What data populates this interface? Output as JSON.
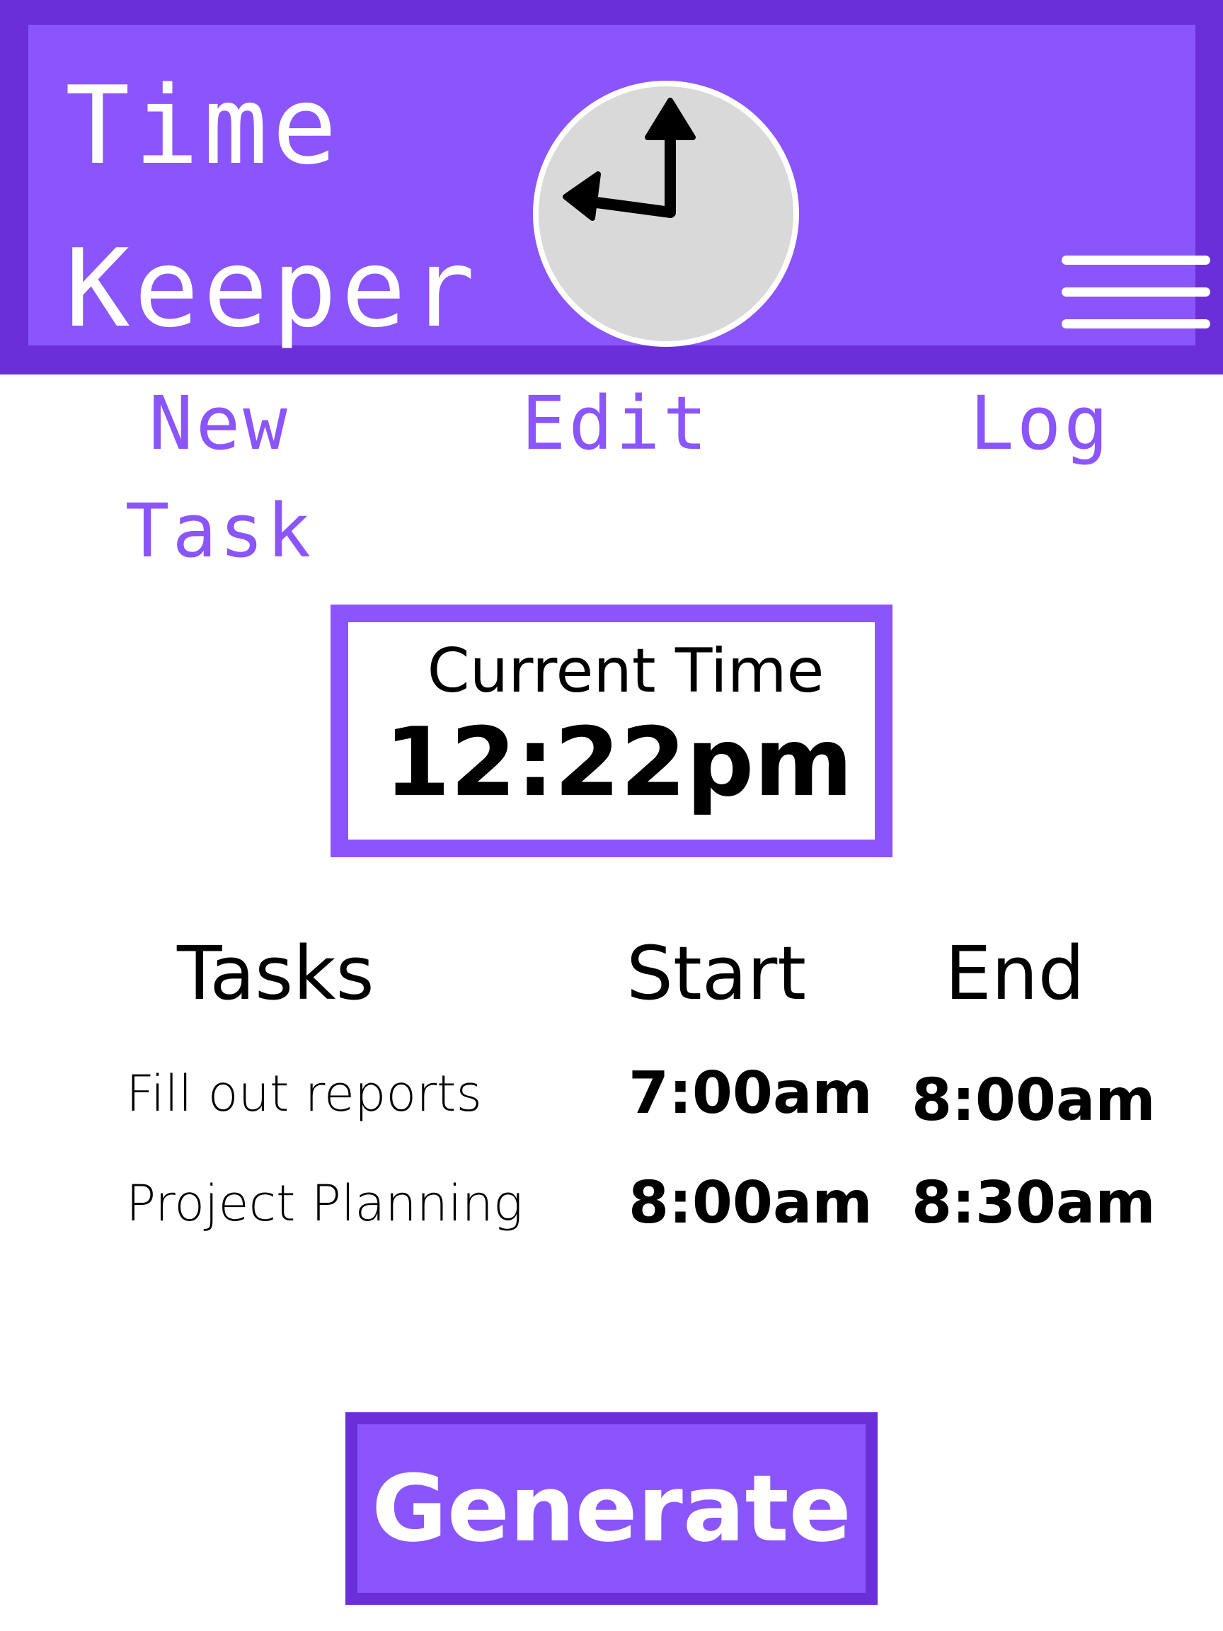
{
  "colors": {
    "header_border": "#6a2fd8",
    "accent": "#8b55fd",
    "clock_face": "#d9d9d9",
    "text": "#000000",
    "on_accent": "#ffffff"
  },
  "header": {
    "title_line1": "Time",
    "title_line2": "Keeper",
    "logo_icon": "clock-icon",
    "menu_icon": "hamburger-menu-icon"
  },
  "nav": {
    "new_line1": "New",
    "new_line2": "Task",
    "edit": "Edit",
    "log": "Log"
  },
  "current_time": {
    "label": "Current Time",
    "value": "12:22pm"
  },
  "tasks_table": {
    "headers": {
      "tasks": "Tasks",
      "start": "Start",
      "end": "End"
    },
    "rows": [
      {
        "task": "Fill out reports",
        "start": "7:00am",
        "end": "8:00am"
      },
      {
        "task": "Project Planning",
        "start": "8:00am",
        "end": "8:30am"
      }
    ]
  },
  "actions": {
    "generate_label": "Generate"
  }
}
